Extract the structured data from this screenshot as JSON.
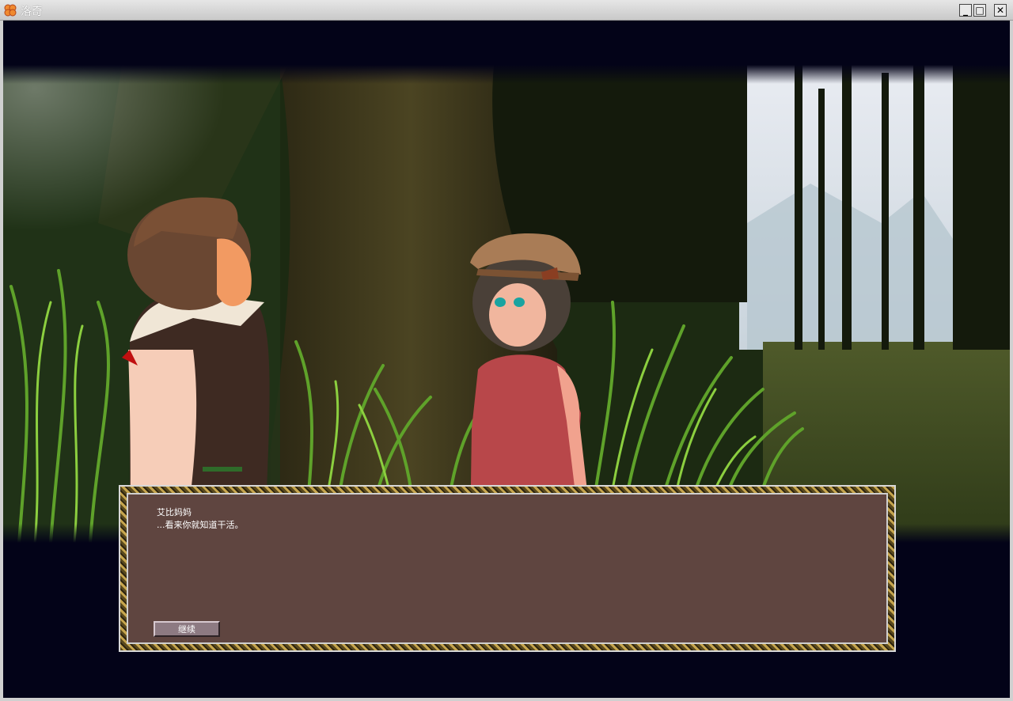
{
  "window": {
    "title": "洛奇",
    "minimize_glyph": "_",
    "maximize_glyph": "□",
    "close_glyph": "✕"
  },
  "dialog": {
    "speaker": "艾比妈妈",
    "text": "...看来你就知道干活。",
    "continue_label": "继续"
  },
  "colors": {
    "dialog_bg": "#5f4540",
    "continue_button": "#8d7a82",
    "viewport_bg": "#030318"
  }
}
